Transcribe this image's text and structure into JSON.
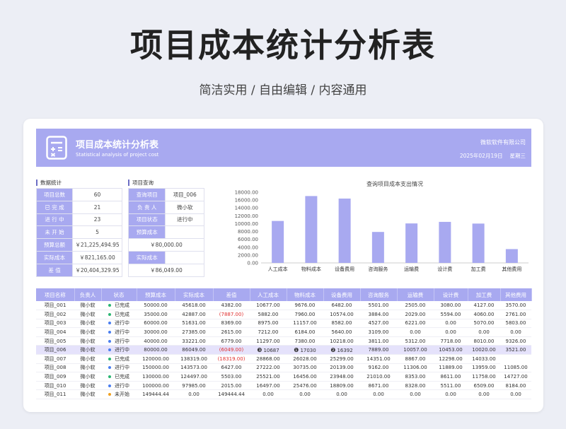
{
  "page": {
    "title": "项目成本统计分析表",
    "subtitle": "简洁实用 / 自由编辑 / 内容通用"
  },
  "banner": {
    "title": "项目成本统计分析表",
    "title_en": "Statistical analysis of project cost",
    "company": "微软软件有限公司",
    "date": "2025年02月19日",
    "weekday": "星期三",
    "color": "#a8a9f0"
  },
  "stats": {
    "section_label": "数据统计",
    "rows": [
      {
        "label": "项目总数",
        "value": "60"
      },
      {
        "label": "已 完 成",
        "value": "21"
      },
      {
        "label": "进 行 中",
        "value": "23"
      },
      {
        "label": "未 开 始",
        "value": "5"
      },
      {
        "label": "预算总额",
        "value": "￥21,225,494.95"
      },
      {
        "label": "实际成本",
        "value": "￥821,165.00"
      },
      {
        "label": "差    值",
        "value": "￥20,404,329.95"
      }
    ]
  },
  "query": {
    "section_label": "项目查询",
    "rows": [
      {
        "label": "查询项目",
        "value": "项目_006"
      },
      {
        "label": "负 责 人",
        "value": "微小软"
      },
      {
        "label": "项目状态",
        "value": "进行中"
      },
      {
        "label": "预算成本",
        "value": ""
      },
      {
        "label": "",
        "value": "￥80,000.00"
      },
      {
        "label": "实际成本",
        "value": ""
      },
      {
        "label": "",
        "value": "￥86,049.00"
      }
    ]
  },
  "chart_data": {
    "type": "bar",
    "title": "查询项目成本支出情况",
    "categories": [
      "人工成本",
      "物料成本",
      "设备费用",
      "咨询服务",
      "运输费",
      "设计费",
      "加工费",
      "其他费用"
    ],
    "values": [
      10687,
      17030,
      16392,
      7889,
      10057,
      10453,
      10020,
      3521
    ],
    "ylim": [
      0,
      18000
    ],
    "yticks": [
      "0.00",
      "2000.00",
      "4000.00",
      "6000.00",
      "8000.00",
      "10000.00",
      "12000.00",
      "14000.00",
      "16000.00",
      "18000.00"
    ],
    "grid": false,
    "bar_color": "#a8a9f0"
  },
  "table": {
    "headers": [
      "项目名称",
      "负责人",
      "状态",
      "预算成本",
      "实际成本",
      "差值",
      "人工成本",
      "物料成本",
      "设备费用",
      "咨询服务",
      "运输费",
      "设计费",
      "加工费",
      "其他费用"
    ],
    "rows": [
      [
        "项目_001",
        "微小软",
        "已完成",
        "50000.00",
        "45618.00",
        "4382.00",
        "10677.00",
        "9676.00",
        "6482.00",
        "5501.00",
        "2505.00",
        "3080.00",
        "4127.00",
        "3570.00"
      ],
      [
        "项目_002",
        "微小软",
        "已完成",
        "35000.00",
        "42887.00",
        "(7887.00)",
        "5882.00",
        "7960.00",
        "10574.00",
        "3884.00",
        "2029.00",
        "5594.00",
        "4060.00",
        "2761.00"
      ],
      [
        "项目_003",
        "微小软",
        "进行中",
        "60000.00",
        "51631.00",
        "8369.00",
        "8975.00",
        "11157.00",
        "8582.00",
        "4527.00",
        "6221.00",
        "0.00",
        "5070.00",
        "5803.00"
      ],
      [
        "项目_004",
        "微小软",
        "进行中",
        "30000.00",
        "27385.00",
        "2615.00",
        "7212.00",
        "6184.00",
        "5640.00",
        "3109.00",
        "0.00",
        "0.00",
        "0.00",
        "0.00"
      ],
      [
        "项目_005",
        "微小软",
        "进行中",
        "40000.00",
        "33221.00",
        "6779.00",
        "11297.00",
        "7380.00",
        "10218.00",
        "3811.00",
        "5312.00",
        "7718.00",
        "8010.00",
        "9326.00"
      ],
      [
        "项目_006",
        "微小软",
        "进行中",
        "80000.00",
        "86049.00",
        "(6049.00)",
        "10687",
        "17030",
        "16392",
        "7889.00",
        "10057.00",
        "10453.00",
        "10020.00",
        "3521.00"
      ],
      [
        "项目_007",
        "微小软",
        "已完成",
        "120000.00",
        "138319.00",
        "(18319.00)",
        "28868.00",
        "26028.00",
        "25299.00",
        "14351.00",
        "8867.00",
        "12298.00",
        "14033.00"
      ],
      [
        "项目_008",
        "微小软",
        "进行中",
        "150000.00",
        "143573.00",
        "6427.00",
        "27222.00",
        "30735.00",
        "20139.00",
        "9162.00",
        "11306.00",
        "11889.00",
        "13959.00",
        "11085.00"
      ],
      [
        "项目_009",
        "微小软",
        "已完成",
        "130000.00",
        "124497.00",
        "5503.00",
        "25521.00",
        "16456.00",
        "23948.00",
        "21010.00",
        "8353.00",
        "8611.00",
        "11758.00",
        "14727.00"
      ],
      [
        "项目_010",
        "微小软",
        "进行中",
        "100000.00",
        "97985.00",
        "2015.00",
        "16497.00",
        "25476.00",
        "18809.00",
        "8671.00",
        "8328.00",
        "5511.00",
        "6509.00",
        "8184.00"
      ],
      [
        "项目_011",
        "微小软",
        "未开始",
        "149444.44",
        "0.00",
        "149444.44",
        "0.00",
        "0.00",
        "0.00",
        "0.00",
        "0.00",
        "0.00",
        "0.00",
        "0.00"
      ]
    ],
    "status_colors": {
      "已完成": "#2bb673",
      "进行中": "#4a7ef0",
      "未开始": "#f0a020"
    },
    "highlight_row": 5,
    "rank_icons": [
      "❶",
      "❷",
      "❸"
    ],
    "negative_color": "#e03030"
  }
}
